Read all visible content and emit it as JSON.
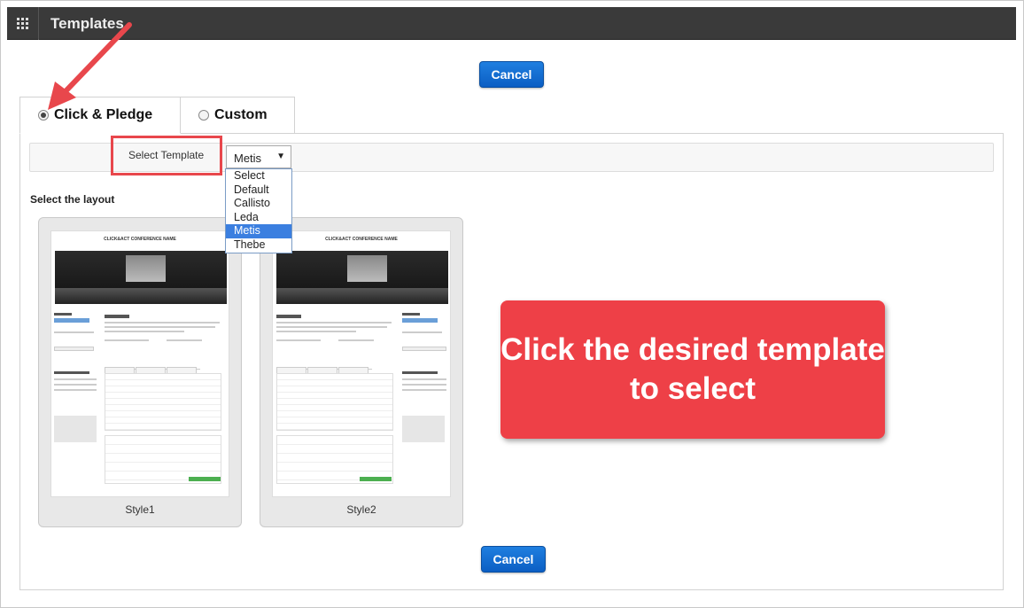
{
  "header": {
    "title": "Templates"
  },
  "buttons": {
    "cancel_top": "Cancel",
    "cancel_bottom": "Cancel"
  },
  "tabs": [
    {
      "label": "Click & Pledge",
      "selected": true
    },
    {
      "label": "Custom",
      "selected": false
    }
  ],
  "template_select": {
    "label": "Select Template",
    "value": "Metis",
    "options": [
      "Select",
      "Default",
      "Callisto",
      "Leda",
      "Metis",
      "Thebe"
    ],
    "highlighted": "Metis"
  },
  "layout": {
    "label": "Select the layout",
    "styles": [
      {
        "name": "Style1",
        "preview_title": "CLICK&ACT CONFERENCE NAME"
      },
      {
        "name": "Style2",
        "preview_title": "CLICK&ACT CONFERENCE NAME"
      }
    ]
  },
  "callout": {
    "text": "Click the desired template to select"
  },
  "colors": {
    "accent_blue": "#1f7fe0",
    "callout_red": "#ee4047",
    "header_bg": "#3a3a3a"
  }
}
